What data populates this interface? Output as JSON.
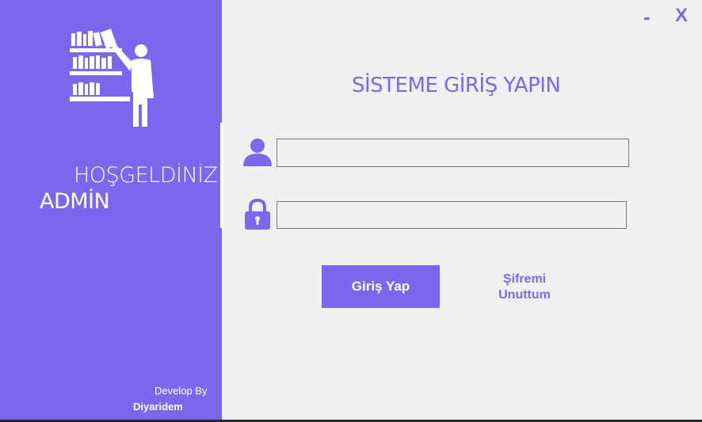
{
  "sidebar": {
    "welcome": "HOŞGELDİNİZ",
    "role": "ADMİN",
    "develop_by": "Develop By",
    "developer": "Diyaridem",
    "logo_icon": "librarian-bookshelf-icon"
  },
  "window_controls": {
    "minimize": "-",
    "close": "X"
  },
  "form": {
    "title": "SİSTEME GİRİŞ YAPIN",
    "username_icon": "user-icon",
    "username_value": "",
    "password_icon": "lock-icon",
    "password_value": "",
    "login_label": "Giriş Yap",
    "forgot_label": "Şifremi\nUnuttum"
  },
  "colors": {
    "accent": "#7b68ee",
    "background": "#f0f0f0",
    "text_on_accent": "#ffffff"
  }
}
